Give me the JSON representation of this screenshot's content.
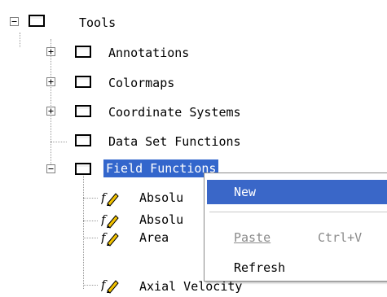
{
  "tree": {
    "root_label": "Tools",
    "children": [
      {
        "label": "Annotations",
        "expander": "plus"
      },
      {
        "label": "Colormaps",
        "expander": "plus"
      },
      {
        "label": "Coordinate Systems",
        "expander": "plus"
      },
      {
        "label": "Data Set Functions",
        "expander": "none"
      },
      {
        "label": "Field Functions",
        "expander": "minus",
        "selected": true
      }
    ],
    "field_functions": [
      {
        "label": "Absolu",
        "icon": "function-pencil-icon"
      },
      {
        "label": "Absolu",
        "icon": "function-pencil-icon"
      },
      {
        "label": "Area",
        "icon": "function-pencil-icon"
      },
      {
        "label": "Axial Velocity",
        "icon": "function-pencil-icon"
      }
    ]
  },
  "context_menu": {
    "items": [
      {
        "label": "New",
        "state": "highlighted"
      },
      {
        "label": "Paste",
        "shortcut": "Ctrl+V",
        "state": "disabled"
      },
      {
        "label": "Refresh",
        "state": "normal"
      }
    ]
  },
  "colors": {
    "selection": "#3366cc",
    "menu_highlight": "#3a67c8",
    "folder_fill": "#ffffff",
    "folder_border": "#000000",
    "tree_lines": "#9a9a9a",
    "disabled_text": "#8a8a8a"
  }
}
